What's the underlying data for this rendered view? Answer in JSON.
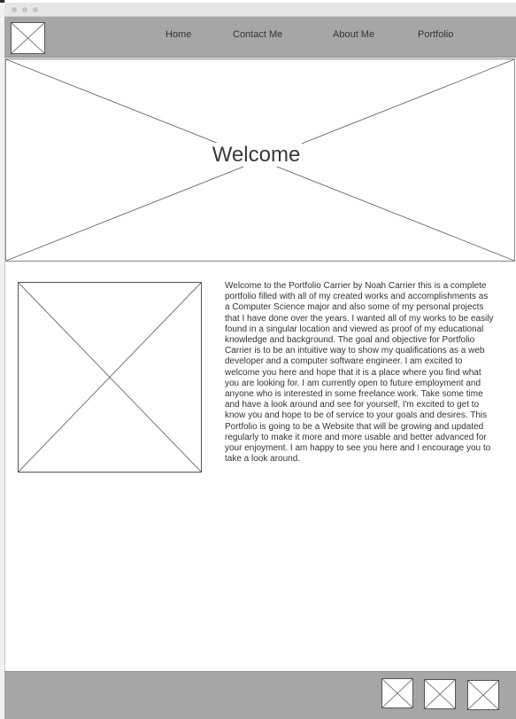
{
  "nav": {
    "links": [
      "Home",
      "Contact Me",
      "About Me",
      "Portfolio"
    ]
  },
  "hero": {
    "title": "Welcome"
  },
  "about": {
    "text": "Welcome to the Portfolio Carrier by Noah Carrier this is a complete portfolio filled with all of my created works and accomplishments as a Computer Science major and also some of my personal projects that I have done over the years. I wanted all of my works to be easily found in a singular location and viewed as proof of my educational knowledge and background. The goal and objective for Portfolio Carrier is to be an intuitive way to show my qualifications as a web developer and a computer software engineer. I am excited to welcome you here and hope that it is a place where you find what you are looking for. I am currently open to future employment and anyone who is interested in some freelance work. Take some time and have a look around and see for yourself, I'm excited to get to know you and hope to be of service to your goals and desires. This Portfolio is going to be a Website that will be growing and updated regularly to make it more and more usable and better advanced for your enjoyment. I am happy to see you here and I encourage you to take a look around."
  },
  "colors": {
    "header_bg": "#a6a6a6",
    "footer_bg": "#a6a6a6",
    "text": "#333333"
  },
  "icons": [
    "logo-placeholder-icon",
    "image-placeholder-icon",
    "social-placeholder-icon"
  ]
}
